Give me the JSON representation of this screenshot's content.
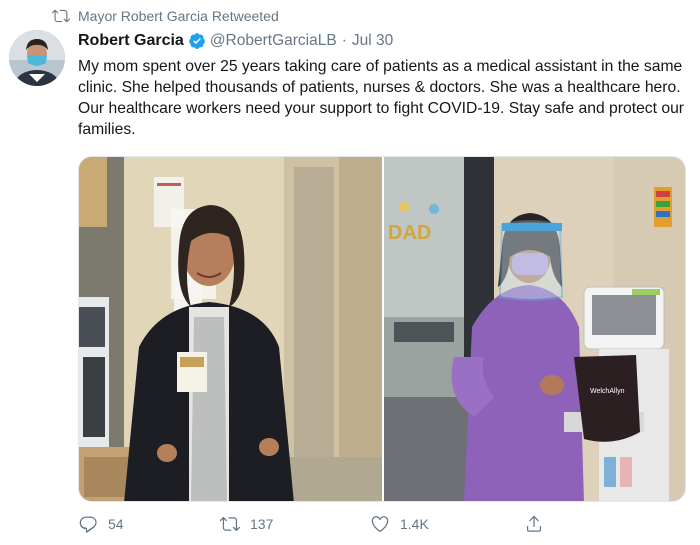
{
  "retweet_banner": {
    "text": "Mayor Robert Garcia Retweeted",
    "icon": "retweet-icon"
  },
  "tweet": {
    "author_name": "Robert Garcia",
    "verified": true,
    "handle": "@RobertGarciaLB",
    "separator": "·",
    "date": "Jul 30",
    "text": "My mom spent over 25 years taking care of patients as a medical assistant in the same clinic. She helped thousands of patients, nurses & doctors. She was a healthcare hero. Our healthcare workers need your support to fight COVID-19. Stay safe and protect our families.",
    "photos": [
      {
        "name": "photo-left",
        "description": "woman in black scrub jacket standing in clinic hallway"
      },
      {
        "name": "photo-right",
        "balloon_text": "DAD",
        "monitor_label": "WelchAllyn"
      }
    ]
  },
  "actions": {
    "reply_count": "54",
    "retweet_count": "137",
    "like_count": "1.4K"
  },
  "colors": {
    "accent": "#1da1f2",
    "muted": "#657786",
    "text": "#14171a"
  }
}
